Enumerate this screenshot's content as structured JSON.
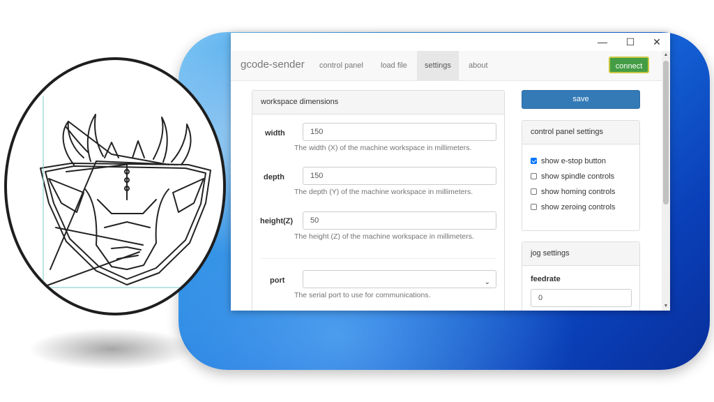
{
  "window": {
    "controls": {
      "minimize": "—",
      "maximize": "☐",
      "close": "✕"
    }
  },
  "navbar": {
    "brand": "gcode-sender",
    "tabs": [
      {
        "label": "control panel",
        "active": false
      },
      {
        "label": "load file",
        "active": false
      },
      {
        "label": "settings",
        "active": true
      },
      {
        "label": "about",
        "active": false
      }
    ],
    "connect_label": "connect"
  },
  "workspace": {
    "heading": "workspace dimensions",
    "fields": [
      {
        "label": "width",
        "value": "150",
        "help": "The width (X) of the machine workspace in millimeters."
      },
      {
        "label": "depth",
        "value": "150",
        "help": "The depth (Y) of the machine workspace in millimeters."
      },
      {
        "label": "height(Z)",
        "value": "50",
        "help": "The height (Z) of the machine workspace in millimeters."
      }
    ],
    "port": {
      "label": "port",
      "value": "",
      "help": "The serial port to use for communications."
    }
  },
  "save_label": "save",
  "control_panel_settings": {
    "heading": "control panel settings",
    "options": [
      {
        "label": "show e-stop button",
        "checked": true
      },
      {
        "label": "show spindle controls",
        "checked": false
      },
      {
        "label": "show homing controls",
        "checked": false
      },
      {
        "label": "show zeroing controls",
        "checked": false
      }
    ]
  },
  "jog_settings": {
    "heading": "jog settings",
    "feedrate_label": "feedrate",
    "feedrate_value": "0"
  },
  "colors": {
    "connect": "#449d44",
    "save": "#337ab7",
    "backdrop": "#1565d8"
  }
}
